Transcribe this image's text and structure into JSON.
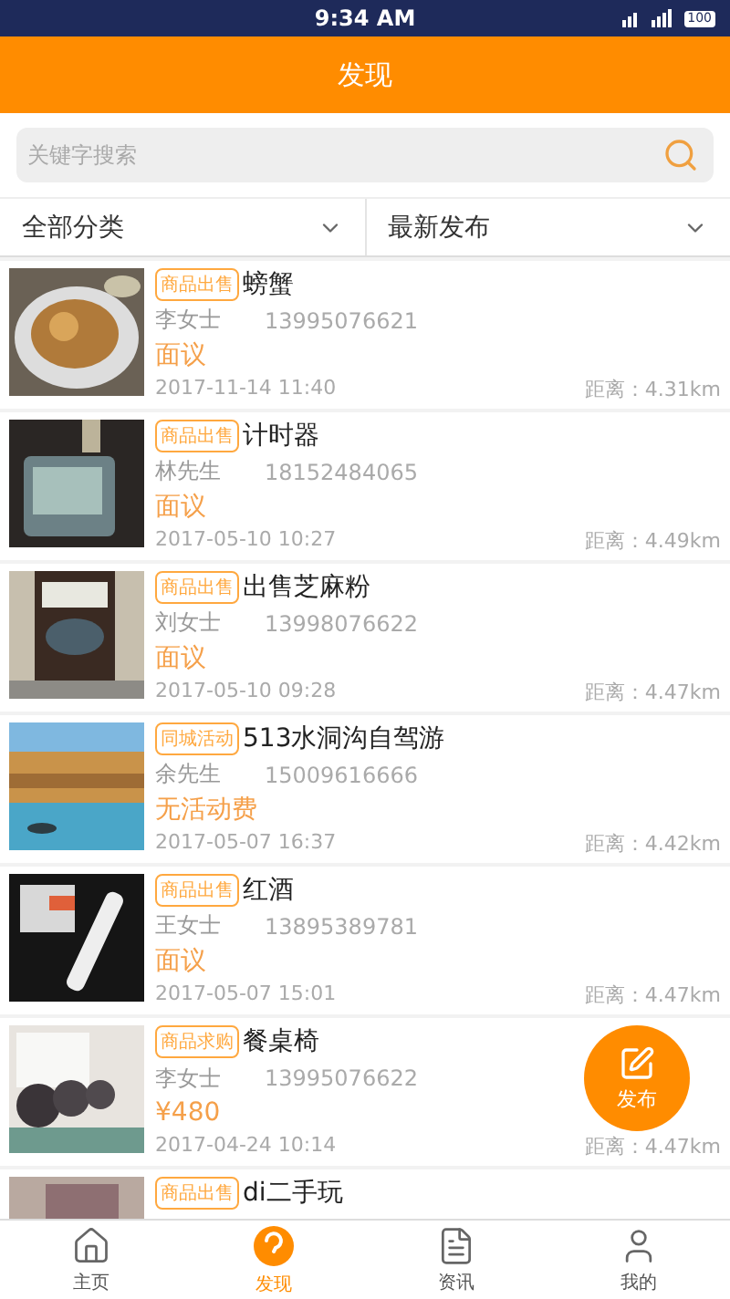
{
  "status_bar": {
    "time": "9:34 AM",
    "battery": "100"
  },
  "header": {
    "title": "发现"
  },
  "search": {
    "placeholder": "关键字搜索"
  },
  "filters": [
    {
      "label": "全部分类"
    },
    {
      "label": "最新发布"
    }
  ],
  "listings": [
    {
      "tag": "商品出售",
      "title": "螃蟹",
      "contact": "李女士",
      "phone": "13995076621",
      "price": "面议",
      "date": "2017-11-14 11:40",
      "distance": "距离：4.31km"
    },
    {
      "tag": "商品出售",
      "title": "计时器",
      "contact": "林先生",
      "phone": "18152484065",
      "price": "面议",
      "date": "2017-05-10 10:27",
      "distance": "距离：4.49km"
    },
    {
      "tag": "商品出售",
      "title": "出售芝麻粉",
      "contact": "刘女士",
      "phone": "13998076622",
      "price": "面议",
      "date": "2017-05-10 09:28",
      "distance": "距离：4.47km"
    },
    {
      "tag": "同城活动",
      "title": "513水洞沟自驾游",
      "contact": "余先生",
      "phone": "15009616666",
      "price": "无活动费",
      "date": "2017-05-07 16:37",
      "distance": "距离：4.42km"
    },
    {
      "tag": "商品出售",
      "title": "红酒",
      "contact": "王女士",
      "phone": "13895389781",
      "price": "面议",
      "date": "2017-05-07 15:01",
      "distance": "距离：4.47km"
    },
    {
      "tag": "商品求购",
      "title": "餐桌椅",
      "contact": "李女士",
      "phone": "13995076622",
      "price": "¥480",
      "date": "2017-04-24 10:14",
      "distance": "距离：4.47km"
    },
    {
      "tag": "商品出售",
      "title": "di二手玩"
    }
  ],
  "fab": {
    "label": "发布"
  },
  "tabs": [
    {
      "label": "主页",
      "selected": false
    },
    {
      "label": "发现",
      "selected": true
    },
    {
      "label": "资讯",
      "selected": false
    },
    {
      "label": "我的",
      "selected": false
    }
  ]
}
